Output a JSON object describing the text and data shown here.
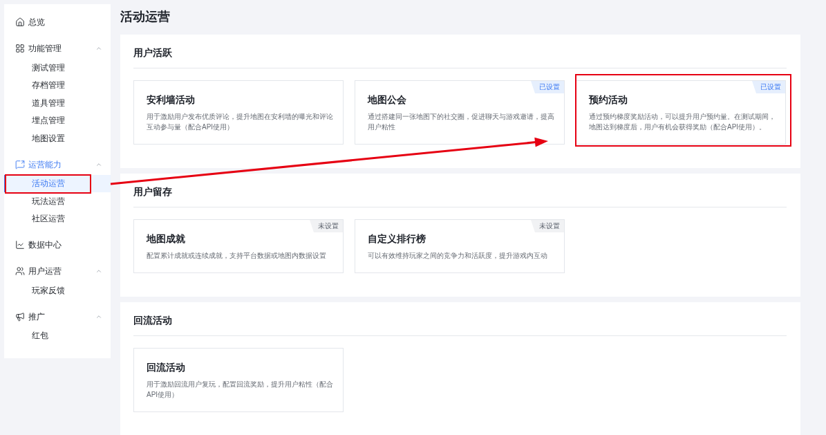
{
  "sidebar": {
    "items": [
      {
        "kind": "link",
        "label": "总览",
        "selected": false
      },
      {
        "kind": "group",
        "label": "功能管理",
        "expanded": true,
        "children": [
          {
            "label": "测试管理",
            "selected": false,
            "highlighted": false
          },
          {
            "label": "存档管理",
            "selected": false,
            "highlighted": false
          },
          {
            "label": "道具管理",
            "selected": false,
            "highlighted": false
          },
          {
            "label": "埋点管理",
            "selected": false,
            "highlighted": false
          },
          {
            "label": "地图设置",
            "selected": false,
            "highlighted": false
          }
        ]
      },
      {
        "kind": "group",
        "label": "运营能力",
        "expanded": true,
        "children": [
          {
            "label": "活动运营",
            "selected": true,
            "highlighted": true
          },
          {
            "label": "玩法运营",
            "selected": false,
            "highlighted": false
          },
          {
            "label": "社区运营",
            "selected": false,
            "highlighted": false
          }
        ]
      },
      {
        "kind": "link",
        "label": "数据中心",
        "selected": false
      },
      {
        "kind": "group",
        "label": "用户运营",
        "expanded": true,
        "children": [
          {
            "label": "玩家反馈",
            "selected": false,
            "highlighted": false
          }
        ]
      },
      {
        "kind": "group",
        "label": "推广",
        "expanded": true,
        "children": [
          {
            "label": "红包",
            "selected": false,
            "highlighted": false
          }
        ]
      }
    ]
  },
  "page_title": "活动运营",
  "sections": [
    {
      "title": "用户活跃",
      "cards": [
        {
          "title": "安利墙活动",
          "description": "用于激励用户发布优质评论，提升地图在安利墙的曝光和评论互动参与量（配合API使用）",
          "highlighted": false
        },
        {
          "title": "地图公会",
          "description": "通过搭建同一张地图下的社交圈，促进聊天与游戏邀请，提高用户粘性",
          "status": {
            "kind": "set",
            "label": "已设置"
          },
          "highlighted": false
        },
        {
          "title": "预约活动",
          "description": "通过预约梯度奖励活动，可以提升用户预约量。在测试期间，地图达到梯度后，用户有机会获得奖励（配合API使用）。",
          "status": {
            "kind": "set",
            "label": "已设置"
          },
          "highlighted": true
        }
      ]
    },
    {
      "title": "用户留存",
      "cards": [
        {
          "title": "地图成就",
          "description": "配置累计成就或连续成就，支持平台数据或地图内数据设置",
          "status": {
            "kind": "unset",
            "label": "未设置"
          },
          "highlighted": false
        },
        {
          "title": "自定义排行榜",
          "description": "可以有效维持玩家之间的竞争力和活跃度，提升游戏内互动",
          "status": {
            "kind": "unset",
            "label": "未设置"
          },
          "highlighted": false
        }
      ]
    },
    {
      "title": "回流活动",
      "cards": [
        {
          "title": "回流活动",
          "description": "用于激励回流用户复玩，配置回流奖励，提升用户粘性（配合API使用）",
          "highlighted": false
        }
      ]
    }
  ]
}
